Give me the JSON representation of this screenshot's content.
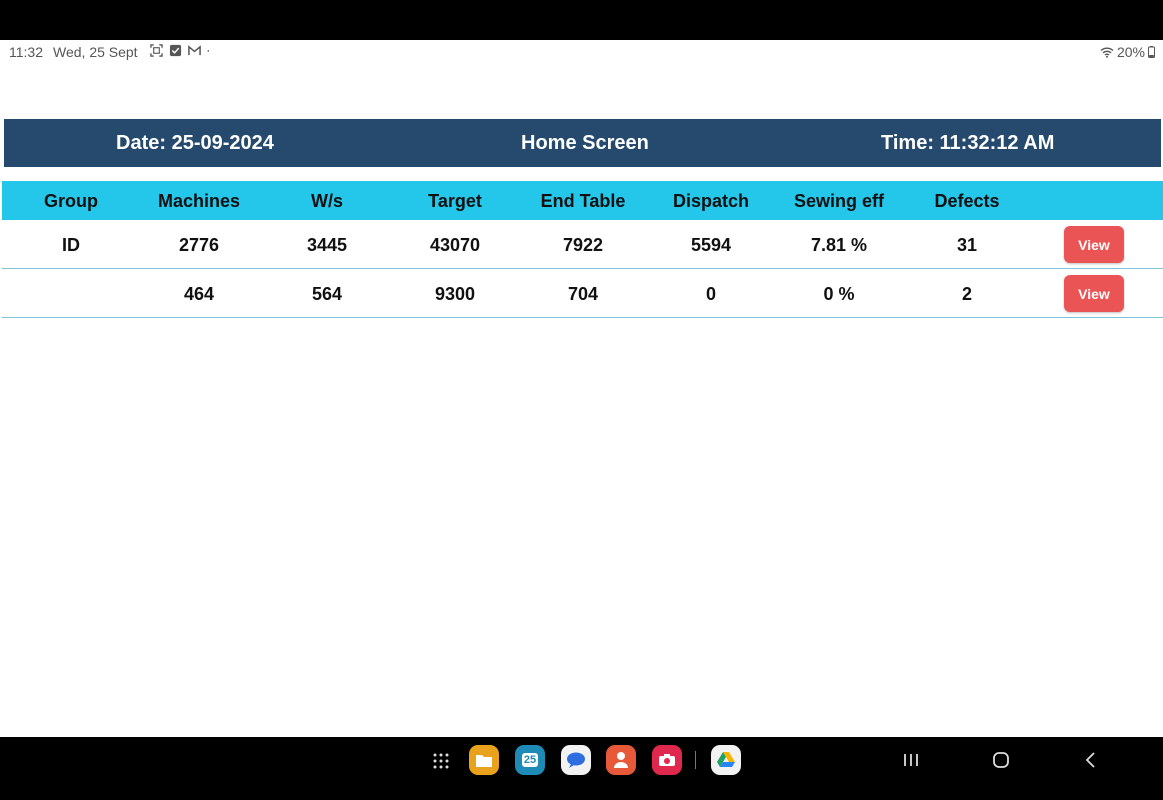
{
  "status_bar": {
    "time": "11:32",
    "date": "Wed, 25 Sept",
    "battery": "20%",
    "icons": [
      "screenshot-icon",
      "check-icon",
      "gmail-icon",
      "dot-icon"
    ],
    "right_icons": [
      "wifi-icon",
      "battery-icon"
    ]
  },
  "header": {
    "date_label": "Date: 25-09-2024",
    "title": "Home Screen",
    "time_label": "Time: 11:32:12 AM",
    "background": "#254a6e"
  },
  "table": {
    "header_color": "#24c6ea",
    "columns": [
      "Group",
      "Machines",
      "W/s",
      "Target",
      "End Table",
      "Dispatch",
      "Sewing eff",
      "Defects"
    ],
    "rows": [
      {
        "group": "ID",
        "machines": "2776",
        "ws": "3445",
        "target": "43070",
        "end_table": "7922",
        "dispatch": "5594",
        "sewing_eff": "7.81 %",
        "defects": "31",
        "action": "View"
      },
      {
        "group": "",
        "machines": "464",
        "ws": "564",
        "target": "9300",
        "end_table": "704",
        "dispatch": "0",
        "sewing_eff": "0 %",
        "defects": "2",
        "action": "View"
      }
    ],
    "button_color": "#ea5455"
  },
  "navbar": {
    "apps": [
      "apps-grid-icon",
      "files-icon",
      "calendar-icon",
      "messages-icon",
      "contacts-icon",
      "camera-icon",
      "drive-icon"
    ],
    "calendar_day": "25",
    "buttons": [
      "recents-icon",
      "home-icon",
      "back-icon"
    ]
  }
}
